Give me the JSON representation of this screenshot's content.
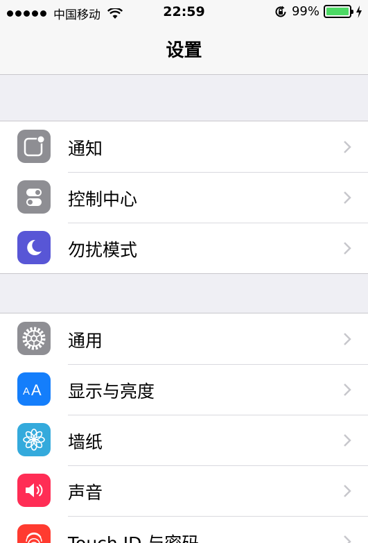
{
  "status_bar": {
    "carrier": "中国移动",
    "time": "22:59",
    "battery_percent": "99%",
    "battery_level": 0.99,
    "battery_color": "#4cd964"
  },
  "nav": {
    "title": "设置"
  },
  "groups": [
    {
      "items": [
        {
          "label": "通知",
          "icon": "notifications-icon",
          "color": "#8e8e93"
        },
        {
          "label": "控制中心",
          "icon": "control-center-icon",
          "color": "#8e8e93"
        },
        {
          "label": "勿扰模式",
          "icon": "moon-icon",
          "color": "#5856d6"
        }
      ]
    },
    {
      "items": [
        {
          "label": "通用",
          "icon": "gear-icon",
          "color": "#8e8e93"
        },
        {
          "label": "显示与亮度",
          "icon": "display-brightness-icon",
          "color": "#147efb"
        },
        {
          "label": "墙纸",
          "icon": "wallpaper-flower-icon",
          "color": "#34aadc"
        },
        {
          "label": "声音",
          "icon": "speaker-icon",
          "color": "#ff2d55"
        },
        {
          "label": "Touch ID 与密码",
          "icon": "fingerprint-icon",
          "color": "#ff3b30"
        }
      ]
    }
  ]
}
